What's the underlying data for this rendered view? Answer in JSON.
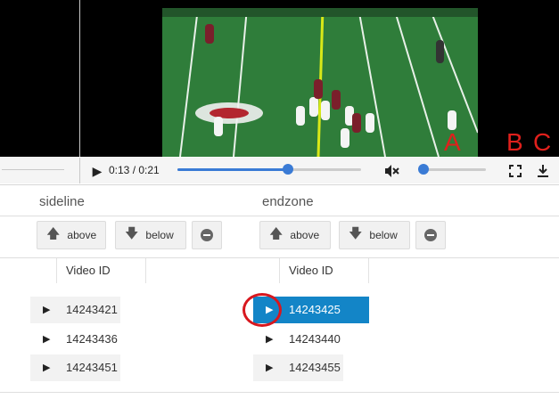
{
  "player": {
    "time": "0:13 / 0:21",
    "progress_fraction": 0.6,
    "volume_fraction": 0.0
  },
  "annotations": [
    "A",
    "B",
    "C"
  ],
  "annotation_color": "#e0201c",
  "accent_color": "#3a7bd5",
  "selected_row_color": "#1385c7",
  "sections": [
    {
      "title": "sideline",
      "buttons": {
        "above": "above",
        "below": "below"
      },
      "column_header": "Video ID",
      "rows": [
        {
          "video_id": "14243421"
        },
        {
          "video_id": "14243436"
        },
        {
          "video_id": "14243451"
        }
      ]
    },
    {
      "title": "endzone",
      "buttons": {
        "above": "above",
        "below": "below"
      },
      "column_header": "Video ID",
      "rows": [
        {
          "video_id": "14243425",
          "selected": true
        },
        {
          "video_id": "14243440"
        },
        {
          "video_id": "14243455"
        }
      ]
    }
  ],
  "icons": {
    "play": "play-icon",
    "mute": "volume-muted-icon",
    "fullscreen": "fullscreen-icon",
    "download": "download-icon",
    "move_up": "arrow-up-icon",
    "move_down": "arrow-down-icon",
    "remove": "remove-icon"
  }
}
